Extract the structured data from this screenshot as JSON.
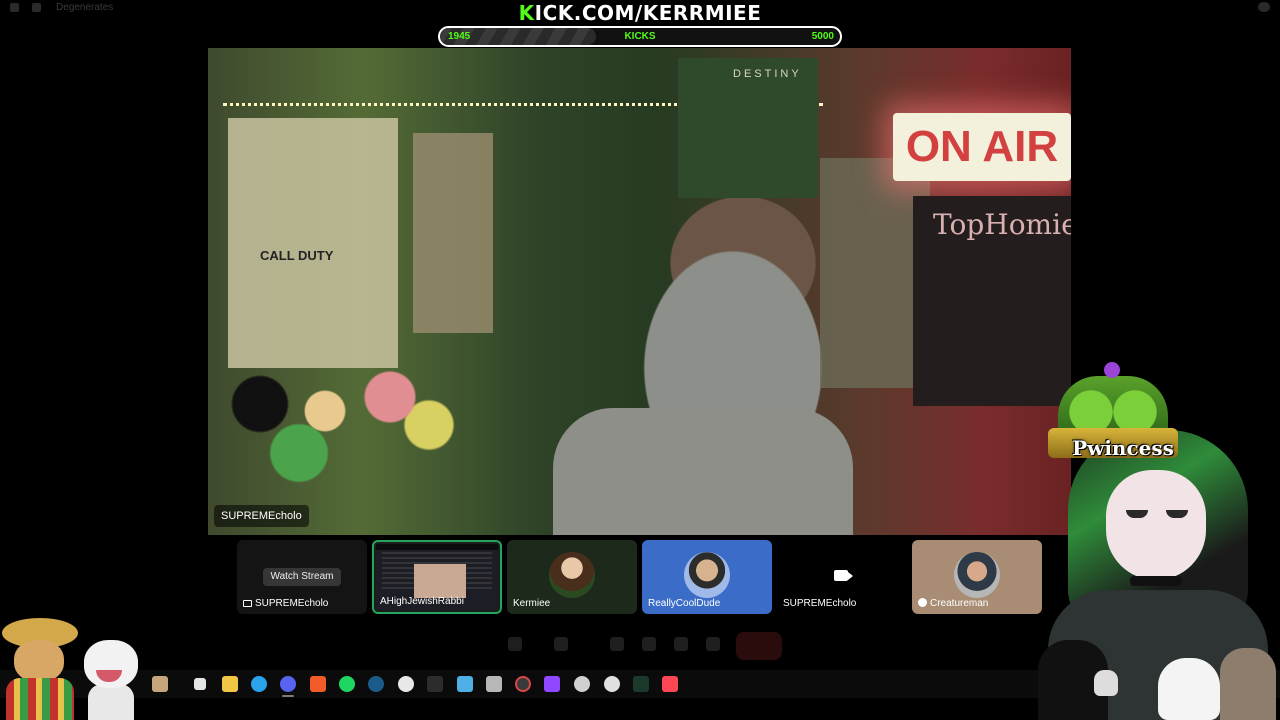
{
  "window": {
    "server_name": "Degenerates"
  },
  "kick_overlay": {
    "channel_prefix": "K",
    "channel_rest": "ICK.COM/KERRMIEE",
    "goal_current": "1945",
    "goal_label": "KICKS",
    "goal_target": "5000",
    "goal_progress_fraction": 0.389
  },
  "main_video": {
    "streamer_label": "SUPREMEcholo",
    "poster_text_destiny": "DESTINY",
    "poster_text_callofduty": "CALL DUTY",
    "sign_text": "ON AIR",
    "board_text": "TopHomie"
  },
  "participants": [
    {
      "name": "SUPREMEcholo",
      "overlay_button": "Watch Stream",
      "kind": "screen-share"
    },
    {
      "name": "AHighJewishRabbi",
      "kind": "screen-share",
      "speaking": true
    },
    {
      "name": "Kermiee",
      "kind": "avatar"
    },
    {
      "name": "ReallyCoolDude",
      "kind": "avatar"
    },
    {
      "name": "SUPREMEcholo",
      "kind": "camera"
    },
    {
      "name": "Creatureman",
      "kind": "xbox-avatar"
    }
  ],
  "overlay": {
    "crown_text": "Pwincess"
  },
  "taskbar": {
    "icons": [
      "search-icon",
      "task-view-icon",
      "file-explorer-icon",
      "edge-icon",
      "discord-icon",
      "brave-icon",
      "spotify-icon",
      "steam-icon",
      "chrome-icon",
      "epic-games-icon",
      "notepad-icon",
      "calculator-icon",
      "obs-icon",
      "twitch-icon",
      "steelseries-icon",
      "steelseries-gg-icon",
      "terminal-icon",
      "valorant-icon"
    ],
    "colors": {
      "accent_green": "#53fc18",
      "speaking_ring": "#23a55a",
      "discord_blue": "#5865f2"
    }
  }
}
